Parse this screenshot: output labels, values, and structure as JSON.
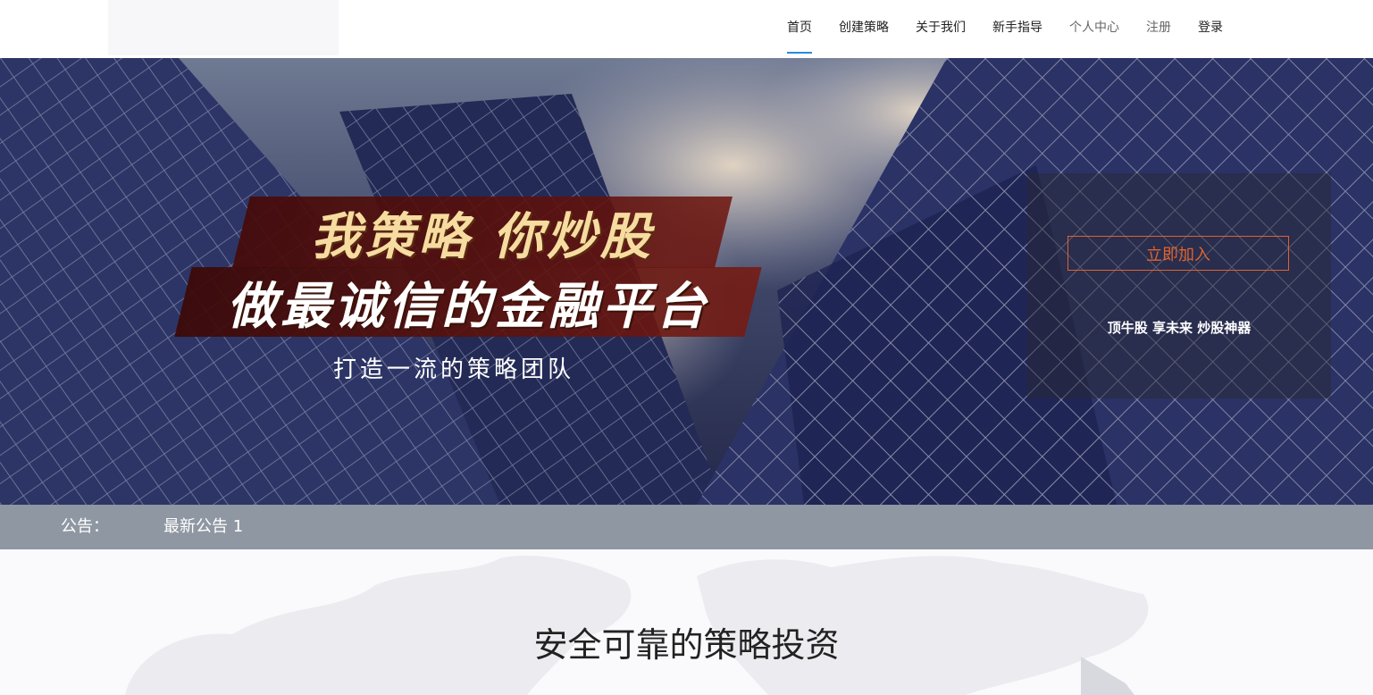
{
  "nav": {
    "items": [
      {
        "label": "首页",
        "active": true
      },
      {
        "label": "创建策略"
      },
      {
        "label": "关于我们"
      },
      {
        "label": "新手指导"
      },
      {
        "label": "个人中心"
      },
      {
        "label": "注册"
      },
      {
        "label": "登录"
      }
    ],
    "active_color": "#2b8ae0"
  },
  "hero": {
    "slogan_line1": "我策略 你炒股",
    "slogan_line2": "做最诚信的金融平台",
    "subtitle": "打造一流的策略团队",
    "join_button": "立即加入",
    "tagline": "顶牛股 享未来 炒股神器",
    "accent_color": "#e0632c"
  },
  "notice": {
    "label": "公告：",
    "item": "最新公告 1"
  },
  "section": {
    "title": "安全可靠的策略投资"
  }
}
